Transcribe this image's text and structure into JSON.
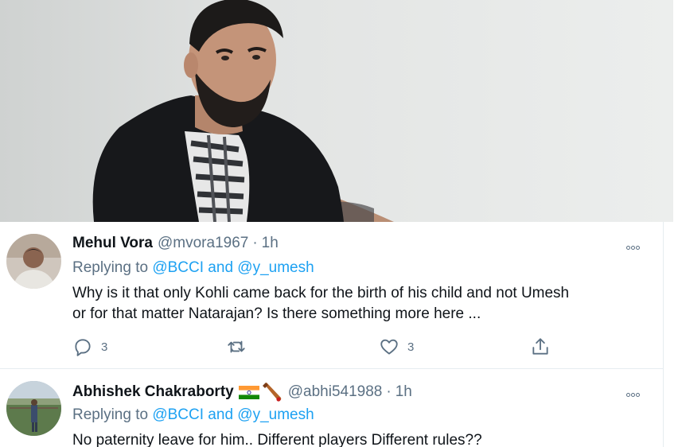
{
  "hero": {
    "image": "portrait-photo"
  },
  "tweets": [
    {
      "name": "Mehul Vora",
      "handle": "@mvora1967",
      "sep": "·",
      "time": "1h",
      "reply_prefix": "Replying to",
      "reply_mentions": "@BCCI and @y_umesh",
      "text_line1": "Why is it that only Kohli came back for the birth of his child and not Umesh",
      "text_line2": "or for that matter Natarajan? Is there something more here ...",
      "reply_count": "3",
      "retweet_count": "",
      "like_count": "3"
    },
    {
      "name": "Abhishek Chakraborty",
      "emoji": [
        "india-flag-icon",
        "cricket-bat-icon"
      ],
      "handle": "@abhi541988",
      "sep": "·",
      "time": "1h",
      "reply_prefix": "Replying to",
      "reply_mentions": "@BCCI and @y_umesh",
      "text_line1": "No paternity leave for him.. Different players Different rules??"
    }
  ],
  "colors": {
    "accent": "#1da1f2",
    "muted": "#5b7083",
    "text": "#0f1419",
    "divider": "#e6ecf0"
  }
}
